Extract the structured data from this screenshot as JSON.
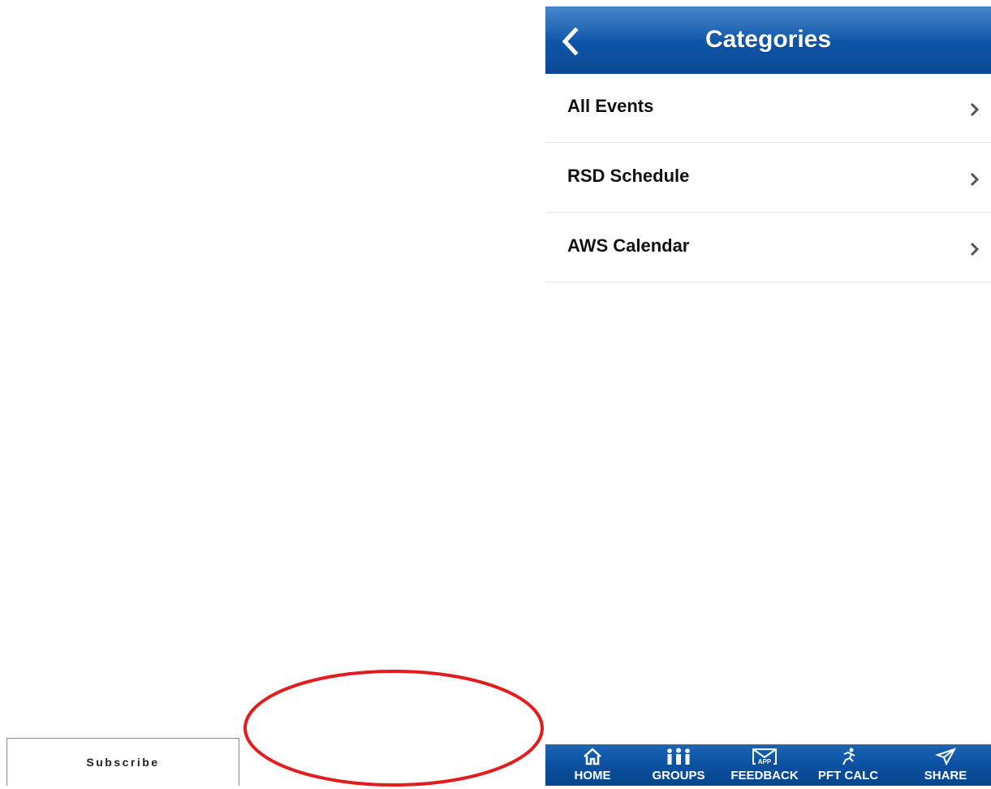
{
  "header": {
    "title": "Categories",
    "back_icon": "chevron-left-icon"
  },
  "categories": [
    {
      "label": "All Events",
      "icon": "chevron-right-icon"
    },
    {
      "label": "RSD Schedule",
      "icon": "chevron-right-icon"
    },
    {
      "label": "AWS Calendar",
      "icon": "chevron-right-icon"
    }
  ],
  "tabbar": {
    "tabs": [
      {
        "label": "HOME",
        "icon": "home-icon"
      },
      {
        "label": "GROUPS",
        "icon": "groups-icon"
      },
      {
        "label": "FEEDBACK",
        "icon": "feedback-icon"
      },
      {
        "label": "PFT CALC",
        "icon": "runner-icon"
      },
      {
        "label": "SHARE",
        "icon": "share-icon"
      }
    ]
  },
  "subscribe": {
    "label": "Subscribe"
  },
  "colors": {
    "header_blue": "#0f56a8",
    "tabbar_blue": "#0c4f9e",
    "annotation_red": "#e01e1e"
  }
}
